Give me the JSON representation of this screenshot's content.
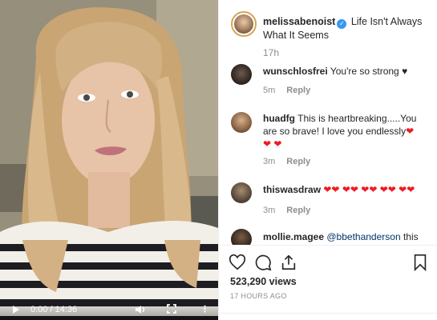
{
  "video": {
    "time": "0:00 / 14:36",
    "controls": {
      "play": "play-icon",
      "volume": "volume-icon",
      "fullscreen": "fullscreen-icon",
      "more": "more-icon"
    }
  },
  "post": {
    "username": "melissabenoist",
    "caption": "Life Isn't Always What It Seems",
    "age": "17h"
  },
  "comments": [
    {
      "username": "wunschlosfrei",
      "text": "You're so strong",
      "tail": "♥",
      "age": "5m",
      "reply": "Reply"
    },
    {
      "username": "huadfg",
      "text": "This is heartbreaking.....You are so brave! I love you endlessly",
      "tail": "❤",
      "line2": "❤ ❤",
      "age": "3m",
      "reply": "Reply"
    },
    {
      "username": "thiswasdraw",
      "text": "",
      "tail": "❤❤ ❤❤ ❤❤ ❤❤ ❤❤",
      "age": "3m",
      "reply": "Reply"
    },
    {
      "username": "mollie.magee",
      "mention": "@bbethanderson",
      "text": "this"
    }
  ],
  "actions": {
    "like": "heart-icon",
    "comment": "comment-icon",
    "share": "share-icon",
    "save": "bookmark-icon",
    "views": "523,290 views",
    "timestamp": "17 HOURS AGO"
  },
  "colors": {
    "accent": "#3897f0",
    "heart": "#ed1c24",
    "muted": "#8e8e8e"
  }
}
